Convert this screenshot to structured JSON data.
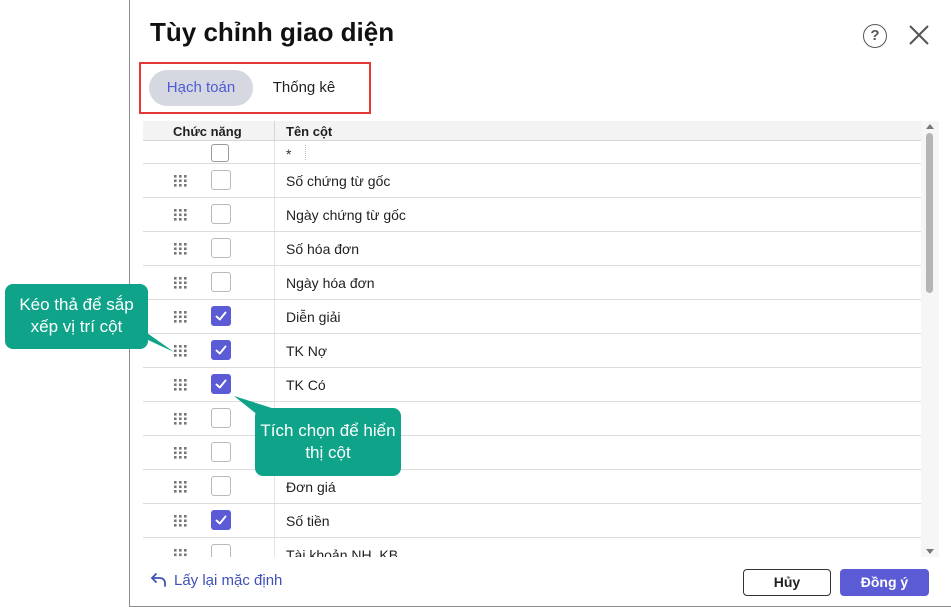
{
  "dialog": {
    "title": "Tùy chỉnh giao diện",
    "help_icon": "question-circle-icon",
    "help_glyph": "?",
    "close_icon": "close-x-icon"
  },
  "tabs": [
    {
      "label": "Hạch toán",
      "active": true
    },
    {
      "label": "Thống kê",
      "active": false
    }
  ],
  "grid": {
    "headers": {
      "function": "Chức năng",
      "column_name": "Tên cột"
    },
    "filter_value": "*",
    "rows": [
      {
        "label": "Số chứng từ gốc",
        "checked": false
      },
      {
        "label": "Ngày chứng từ gốc",
        "checked": false
      },
      {
        "label": "Số hóa đơn",
        "checked": false
      },
      {
        "label": "Ngày hóa đơn",
        "checked": false
      },
      {
        "label": "Diễn giải",
        "checked": true
      },
      {
        "label": "TK Nợ",
        "checked": true
      },
      {
        "label": "TK Có",
        "checked": true
      },
      {
        "label": "",
        "checked": false
      },
      {
        "label": "",
        "checked": false
      },
      {
        "label": "Đơn giá",
        "checked": false
      },
      {
        "label": "Số tiền",
        "checked": true
      },
      {
        "label": "Tài khoản NH, KB",
        "checked": false
      }
    ]
  },
  "footer": {
    "reset_label": "Lấy lại mặc định",
    "cancel_label": "Hủy",
    "ok_label": "Đồng ý"
  },
  "callouts": {
    "drag_hint": "Kéo thả để sắp xếp vị trí cột",
    "check_hint": "Tích chọn để hiển thị cột"
  },
  "colors": {
    "accent": "#5b5bd6",
    "tab_active_bg": "#d5d8e0",
    "highlight_border": "#e53935",
    "callout_bg": "#0fa389"
  }
}
